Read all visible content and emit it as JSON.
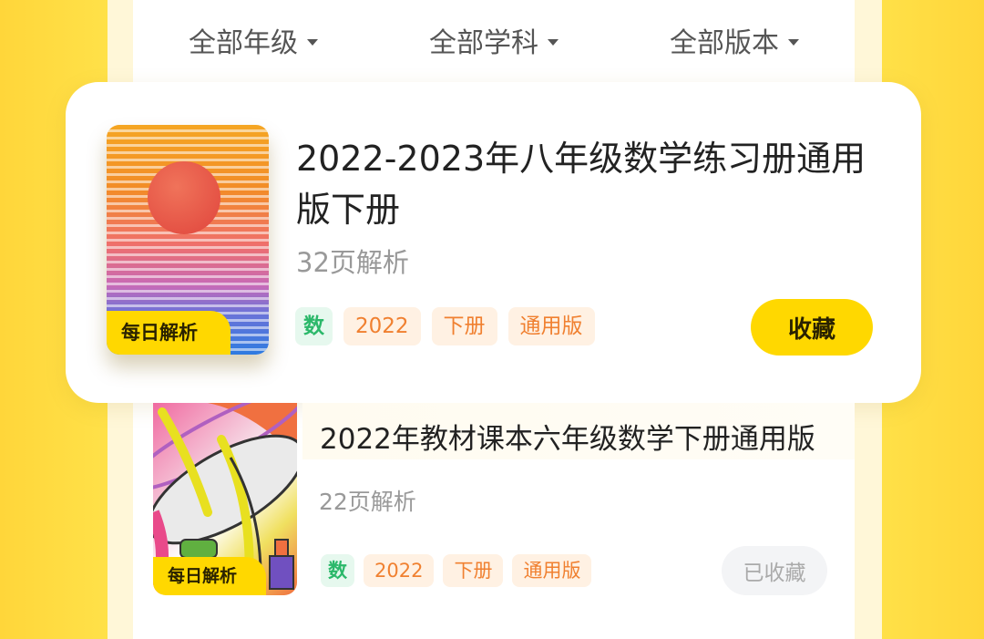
{
  "filters": [
    {
      "label": "全部年级"
    },
    {
      "label": "全部学科"
    },
    {
      "label": "全部版本"
    }
  ],
  "books": [
    {
      "title": "2022-2023年八年级数学练习册通用版下册",
      "pages": "32页解析",
      "badge": "每日解析",
      "subject_tag": "数",
      "tags": [
        "2022",
        "下册",
        "通用版"
      ],
      "action": "收藏",
      "favorited": false
    },
    {
      "title": "2022年教材课本六年级数学下册通用版",
      "pages": "22页解析",
      "badge": "每日解析",
      "subject_tag": "数",
      "tags": [
        "2022",
        "下册",
        "通用版"
      ],
      "action": "已收藏",
      "favorited": true
    }
  ],
  "colors": {
    "accent": "#ffd800",
    "subject_tag_text": "#2bb86a",
    "tag_text": "#f08030"
  }
}
